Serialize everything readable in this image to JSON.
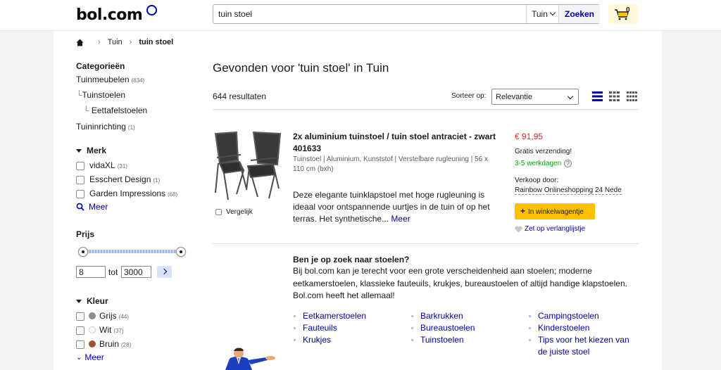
{
  "header": {
    "logo": "bol.com",
    "search_value": "tuin stoel",
    "scope": "Tuin",
    "search_button": "Zoeken",
    "cart_count": "0"
  },
  "breadcrumb": {
    "items": [
      "Tuin",
      "tuin stoel"
    ]
  },
  "sidebar": {
    "categories_title": "Categorieën",
    "categories": [
      {
        "label": "Tuinmeubelen",
        "count": "(634)"
      },
      {
        "label": "Tuinstoelen",
        "count": ""
      },
      {
        "label": "Eettafelstoelen",
        "count": ""
      },
      {
        "label": "Tuininrichting",
        "count": "(1)"
      }
    ],
    "merk_title": "Merk",
    "merk": [
      {
        "label": "vidaXL",
        "count": "(31)"
      },
      {
        "label": "Esschert Design",
        "count": "(1)"
      },
      {
        "label": "Garden Impressions",
        "count": "(68)"
      }
    ],
    "merk_more": "Meer",
    "prijs_title": "Prijs",
    "price_min": "8",
    "price_to": "tot",
    "price_max": "3000",
    "slider_fraction": [
      0.0,
      1.0
    ],
    "kleur_title": "Kleur",
    "kleur": [
      {
        "label": "Grijs",
        "count": "(44)",
        "color": "#8c8c8c"
      },
      {
        "label": "Wit",
        "count": "(37)",
        "color": "#ffffff"
      },
      {
        "label": "Bruin",
        "count": "(28)",
        "color": "#a0522d"
      }
    ],
    "kleur_more": "Meer"
  },
  "results": {
    "title": "Gevonden voor 'tuin stoel' in Tuin",
    "count": "644 resultaten",
    "sort_label": "Sorteer op:",
    "sort_value": "Relevantie"
  },
  "product": {
    "title": "2x aluminium tuinstoel / tuin stoel antraciet - zwart 401633",
    "specs": "Tuinstoel | Aluminium, Kunststof | Verstelbare rugleuning | 56 x 110 cm (bxh)",
    "desc": "Deze elegante tuinklapstoel met hoge rugleuning is ideaal voor ontspannende uurtjes in de tuin of op het terras. Het synthetische...",
    "desc_more": "Meer",
    "compare": "Vergelijk",
    "price": "€ 91,95",
    "shipping": "Gratis verzending!",
    "delivery": "3-5 werkdagen",
    "seller_label": "Verkoop door:",
    "seller": "Rainbow Onlineshopping 24 Nede",
    "cart_button": "In winkelwagentje",
    "wishlist": "Zet op verlanglijstje"
  },
  "info": {
    "heading": "Ben je op zoek naar stoelen?",
    "text": "Bij bol.com kan je terecht voor een grote verscheidenheid aan stoelen; moderne eetkamerstoelen, klassieke fauteuils, krukjes, bureaustoelen of altijd handige klapstoelen. Bol.com heeft het allemaal!",
    "links": [
      "Eetkamerstoelen",
      "Fauteuils",
      "Krukjes",
      "Barkrukken",
      "Bureaustoelen",
      "Tuinstoelen",
      "Campingstoelen",
      "Kinderstoelen",
      "Tips voor het kiezen van de juiste stoel"
    ]
  },
  "colors": {
    "brand_blue": "#0000a4",
    "price_red": "#e02b27",
    "cart_yellow": "#ffc000",
    "delivery_green": "#00a800"
  },
  "icons": [
    "home-icon",
    "cart-icon",
    "search-icon",
    "heart-icon",
    "help-icon",
    "list-view-icon",
    "grid-view-icon",
    "chevron-down-icon"
  ]
}
